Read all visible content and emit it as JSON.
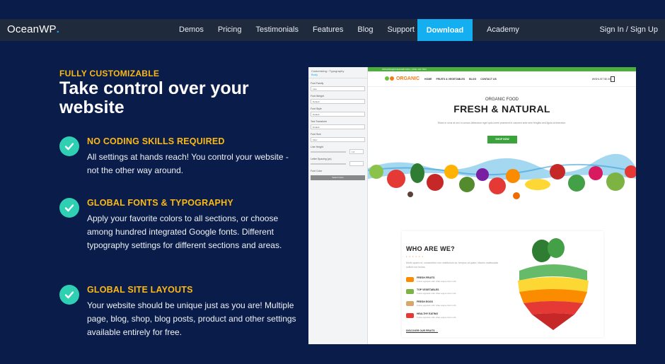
{
  "header": {
    "logo_text": "OceanWP",
    "logo_dot": ".",
    "nav": [
      "Demos",
      "Pricing",
      "Testimonials",
      "Features",
      "Blog",
      "Support"
    ],
    "download_label": "Download",
    "academy_label": "Academy",
    "sign_label": "Sign In / Sign Up"
  },
  "hero": {
    "eyebrow": "FULLY CUSTOMIZABLE",
    "headline": "Take control over your website"
  },
  "features": [
    {
      "title": "NO CODING SKILLS REQUIRED",
      "text": "All settings at hands reach! You control your website - not the other way around."
    },
    {
      "title": "GLOBAL FONTS & TYPOGRAPHY",
      "text": "Apply your favorite colors to all sections, or choose among hundred integrated Google fonts. Different typography settings for different sections and areas."
    },
    {
      "title": "GLOBAL SITE LAYOUTS",
      "text": "Your website should be unique just as you are! Multiple page, blog, shop, blog posts, product and other settings available entirely for free."
    }
  ],
  "colors": {
    "background": "#0a1d4a",
    "navbar": "#1f2a3d",
    "accent": "#13aff0",
    "eyebrow": "#fdb913",
    "check": "#2fcfb3"
  },
  "preview": {
    "customizer": {
      "header": "Customizing › Typography",
      "sub": "Body",
      "labels": [
        "Font Family",
        "Font Weight",
        "Font Style",
        "Text Transform",
        "Font Size",
        "Line Height",
        "Letter Spacing (px)",
        "Font Color"
      ],
      "values": [
        "Lato",
        "Default",
        "Default",
        "Default",
        "15px",
        "1.8",
        "",
        ""
      ],
      "button": "Select Color"
    },
    "site": {
      "strip_text": "ORGANIC@OCEANWP.ORG | (001) 123 7364",
      "logo": "ORGANIC",
      "menu": [
        "HOME",
        "FRUITS & VEGETABLES",
        "BLOG",
        "CONTACT US"
      ],
      "cart": "WISHLIST  $0.00",
      "hero_sub": "ORGANIC FOOD",
      "hero_title": "FRESH & NATURAL",
      "hero_desc": "Etiam in urna at orci in cursus bibendum eget quis lorem praesent in nascent ante sem fringilla sed ligula at interdum.",
      "hero_button": "SHOP NOW",
      "who_title": "WHO ARE WE?",
      "who_dots": "• • • • • •",
      "who_desc": "Morbi quam mi, consectetur non vestibulum ac, tempus at quam. Mauris malesuada sollicit non lectus.",
      "who_items": [
        {
          "title": "FRESH FRUITS",
          "text": "Fusce egestas odio vitae augue lorem elit."
        },
        {
          "title": "TOP VEGETABLES",
          "text": "Fusce egestas odio vitae augue lorem elit."
        },
        {
          "title": "FRESH EGGS",
          "text": "Fusce egestas odio vitae augue lorem elit."
        },
        {
          "title": "HEALTHY EATING",
          "text": "Fusce egestas odio vitae augue lorem elit."
        }
      ],
      "who_link": "DISCOVER OUR FRUITS  →"
    }
  }
}
